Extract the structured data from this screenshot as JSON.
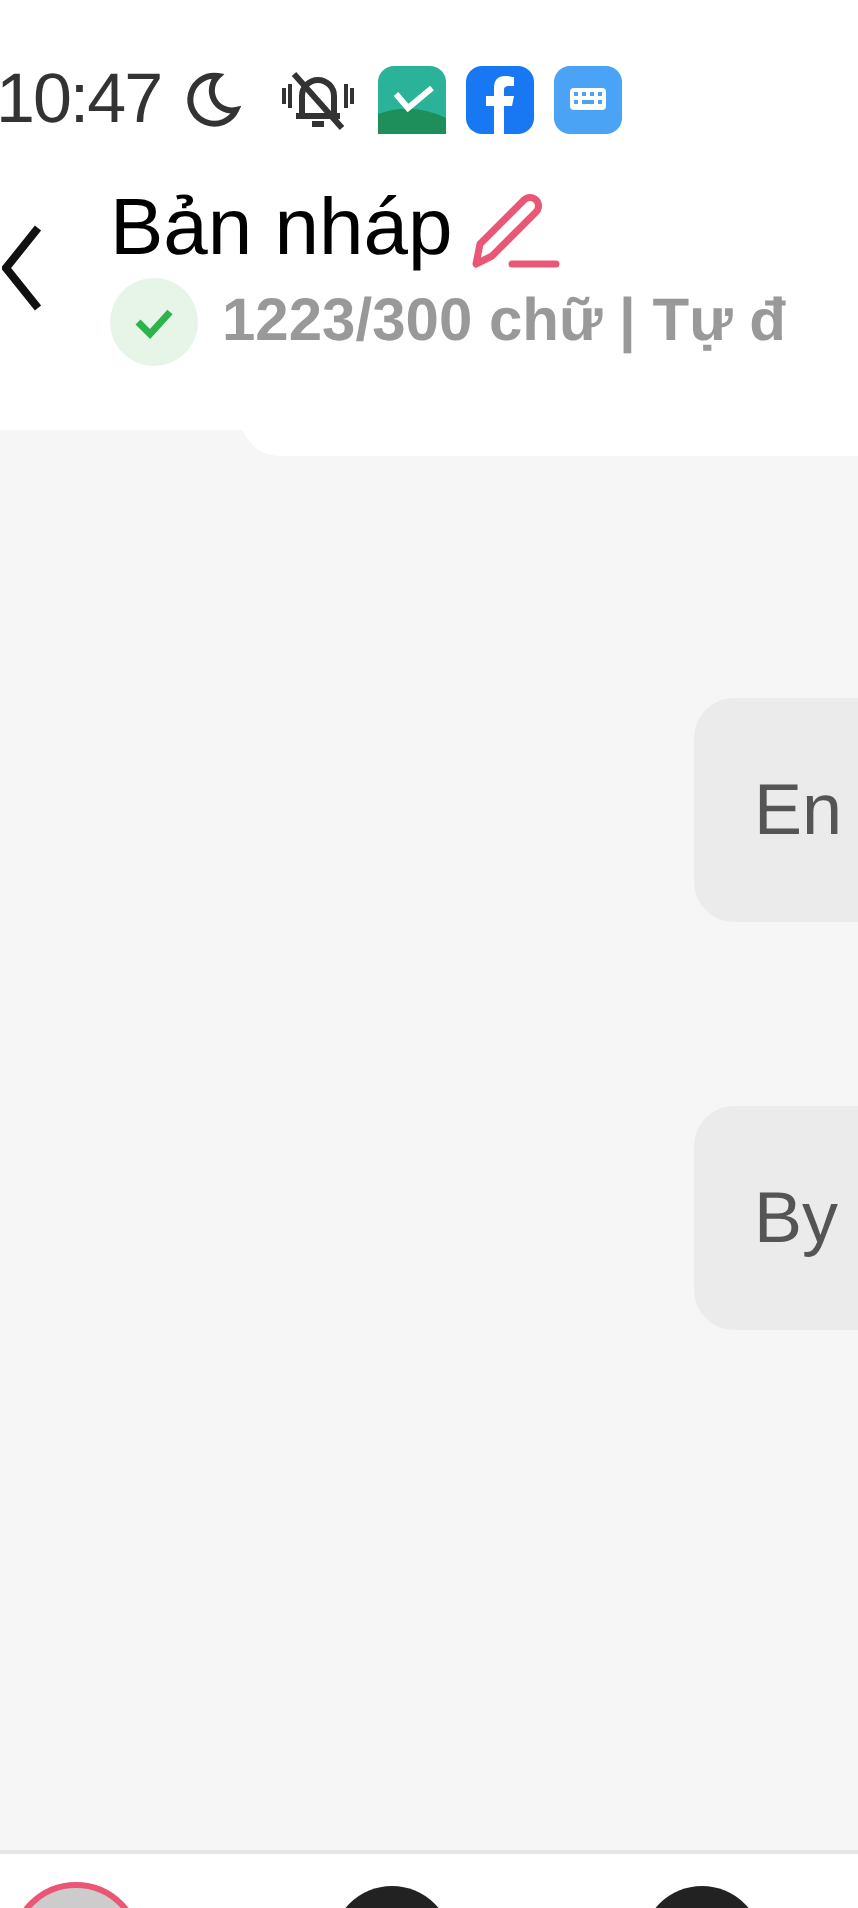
{
  "status_bar": {
    "time": "10:47"
  },
  "header": {
    "title": "Bản nháp",
    "subtitle": "1223/300 chữ | Tự đ",
    "saved": true
  },
  "messages": [
    {
      "kind": "partial"
    },
    {
      "kind": "text",
      "text": "En"
    },
    {
      "kind": "text",
      "text": "By"
    }
  ],
  "bottom_bar": {
    "avatars": [
      {
        "selected": true
      },
      {
        "selected": false
      },
      {
        "selected": false
      }
    ]
  }
}
